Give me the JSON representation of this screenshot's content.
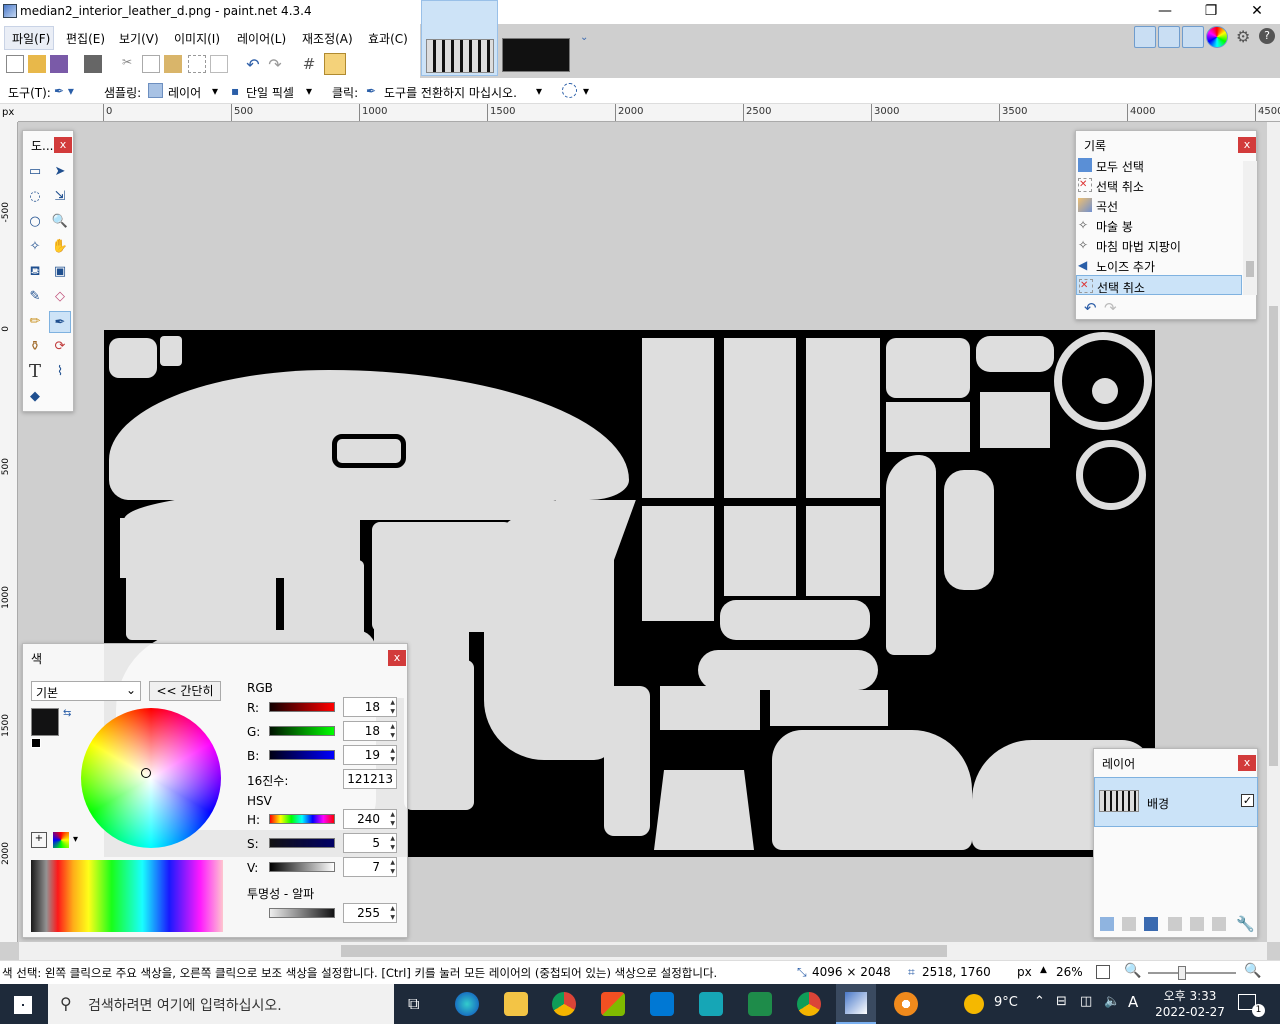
{
  "window": {
    "title": "median2_interior_leather_d.png - paint.net 4.3.4",
    "controls": {
      "minimize": "—",
      "restore": "❐",
      "close": "✕"
    }
  },
  "menu": [
    "파일(F)",
    "편집(E)",
    "보기(V)",
    "이미지(I)",
    "레이어(L)",
    "재조정(A)",
    "효과(C)"
  ],
  "toolbar": {
    "tool_label": "도구(T):",
    "sampling_label": "샘플링:",
    "sampling_value": "레이어",
    "sampling_mode": "단일 픽셀",
    "click_label": "클릭:",
    "click_value": "도구를 전환하지 마십시오."
  },
  "ruler": {
    "unit": "px",
    "top_ticks": [
      "0",
      "500",
      "1000",
      "1500",
      "2000",
      "2500",
      "3000",
      "3500",
      "4000",
      "4500"
    ],
    "left_ticks": [
      "-500",
      "0",
      "500",
      "1000",
      "1500",
      "2000"
    ]
  },
  "tools_panel": {
    "title": "도..."
  },
  "history_panel": {
    "title": "기록",
    "items": [
      {
        "label": "모두 선택",
        "icon": "select-all-icon"
      },
      {
        "label": "선택 취소",
        "icon": "deselect-icon"
      },
      {
        "label": "곡선",
        "icon": "curves-icon"
      },
      {
        "label": "마술 봉",
        "icon": "magic-wand-icon"
      },
      {
        "label": "마침 마법 지팡이",
        "icon": "magic-wand-icon"
      },
      {
        "label": "노이즈 추가",
        "icon": "noise-icon"
      },
      {
        "label": "선택 취소",
        "icon": "deselect-icon"
      }
    ],
    "selected_index": 6
  },
  "layers_panel": {
    "title": "레이어",
    "layers": [
      {
        "name": "배경",
        "visible": true
      }
    ]
  },
  "colors_panel": {
    "title": "색",
    "palette_mode": "기본",
    "toggle_label": "<< 간단히",
    "rgb_label": "RGB",
    "r_label": "R:",
    "r": "18",
    "g_label": "G:",
    "g": "18",
    "b_label": "B:",
    "b": "19",
    "hex_label": "16진수:",
    "hex": "121213",
    "hsv_label": "HSV",
    "h_label": "H:",
    "h": "240",
    "s_label": "S:",
    "s": "5",
    "v_label": "V:",
    "v": "7",
    "alpha_label": "투명성 - 알파",
    "alpha": "255",
    "primary_color": "#121213",
    "secondary_color": "#ffffff"
  },
  "status": {
    "hint": "색 선택: 왼쪽 클릭으로 주요 색상을, 오른쪽 클릭으로 보조 색상을 설정합니다. [Ctrl] 키를 눌러 모든 레이어의 (중첩되어 있는) 색상으로 설정합니다.",
    "image_size": "4096 × 2048",
    "cursor_pos": "2518, 1760",
    "unit": "px",
    "zoom": "26%"
  },
  "taskbar": {
    "search_placeholder": "검색하려면 여기에 입력하십시오.",
    "weather": "9°C",
    "time": "오후 3:33",
    "date": "2022-02-27",
    "ime": "A",
    "notification_count": "1"
  }
}
